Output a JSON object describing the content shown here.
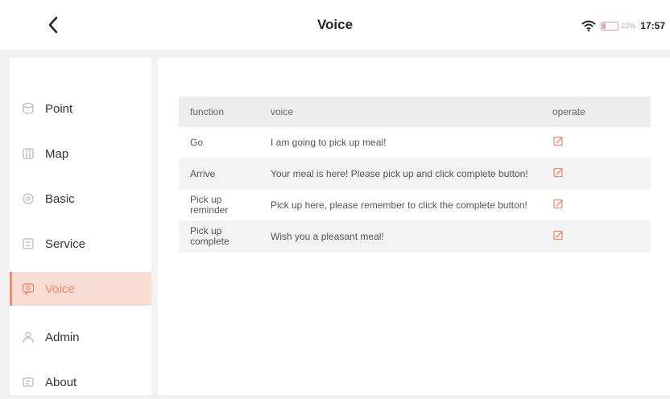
{
  "header": {
    "back_icon": "chevron-left-icon",
    "title": "Voice",
    "wifi_icon": "wifi-icon",
    "battery_icon": "battery-icon",
    "battery_text": "22%",
    "battery_level": 0.22,
    "time": "17:57"
  },
  "sidebar": {
    "items": [
      {
        "label": "Point",
        "icon": "point-icon"
      },
      {
        "label": "Map",
        "icon": "map-icon"
      },
      {
        "label": "Basic",
        "icon": "basic-settings-icon"
      },
      {
        "label": "Service",
        "icon": "service-icon"
      },
      {
        "label": "Voice",
        "icon": "voice-icon",
        "active": true
      },
      {
        "label": "Admin",
        "icon": "admin-icon"
      },
      {
        "label": "About",
        "icon": "about-icon"
      }
    ]
  },
  "table": {
    "headers": {
      "function": "function",
      "voice": "voice",
      "operate": "operate"
    },
    "rows": [
      {
        "function": "Go",
        "voice": "I am going to pick up meal!",
        "operate_icon": "edit-icon"
      },
      {
        "function": "Arrive",
        "voice": "Your meal is here! Please pick up and click complete button!",
        "operate_icon": "edit-icon"
      },
      {
        "function": "Pick up reminder",
        "voice": "Pick up here, please remember to click the complete button!",
        "operate_icon": "edit-icon"
      },
      {
        "function": "Pick up complete",
        "voice": "Wish you a pleasant meal!",
        "operate_icon": "edit-icon"
      }
    ]
  },
  "colors": {
    "accent": "#ef8a6f",
    "active_bg": "#f7dcd3",
    "header_row_bg": "#ececec"
  }
}
